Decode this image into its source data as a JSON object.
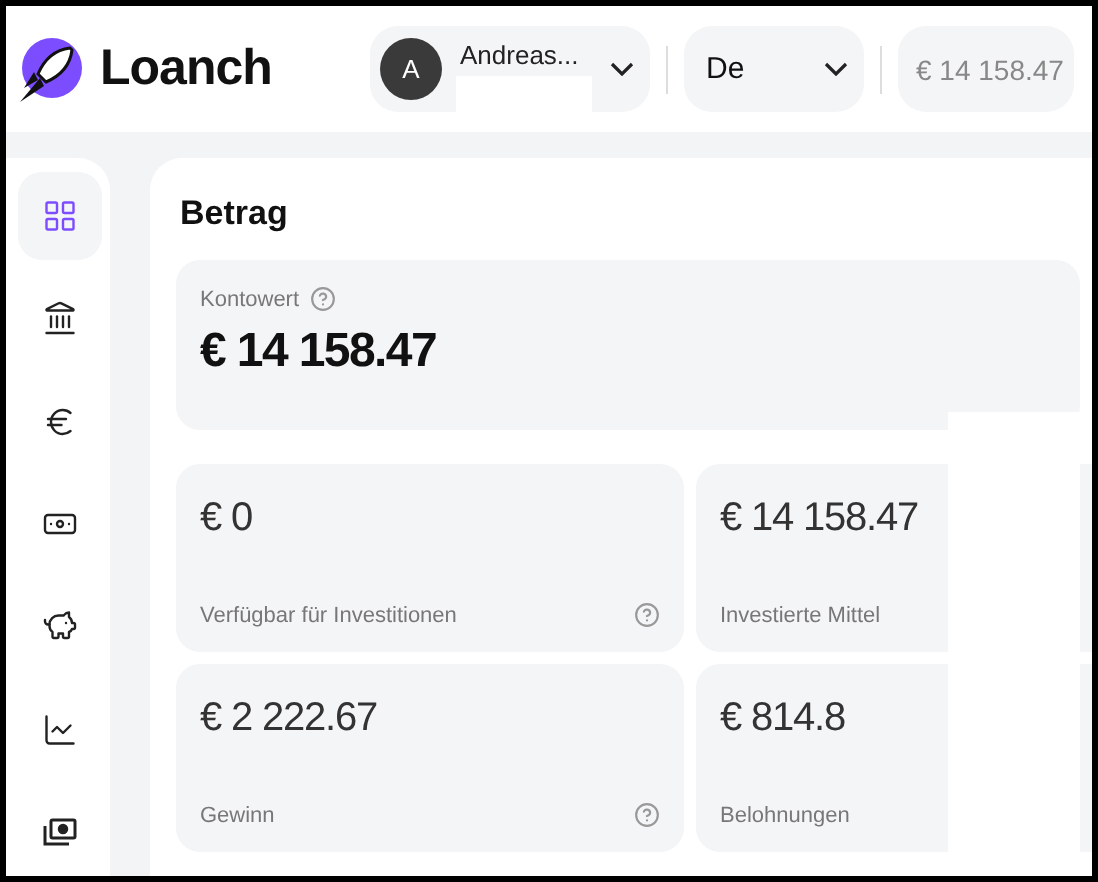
{
  "header": {
    "brand": "Loanch",
    "user": {
      "initial": "A",
      "name": "Andreas..."
    },
    "language": "De",
    "balance": "€ 14 158.47"
  },
  "sidebar": {
    "items": [
      {
        "kind": "grid",
        "selected": true
      },
      {
        "kind": "bank",
        "selected": false
      },
      {
        "kind": "euro",
        "selected": false
      },
      {
        "kind": "banknote",
        "selected": false
      },
      {
        "kind": "piggy",
        "selected": false
      },
      {
        "kind": "chart",
        "selected": false
      },
      {
        "kind": "cash",
        "selected": false
      }
    ]
  },
  "main": {
    "title": "Betrag",
    "summary": {
      "label": "Kontowert",
      "help": true,
      "value": "€ 14 158.47"
    },
    "stats": [
      {
        "value": "€ 0",
        "label": "Verfügbar für Investitionen",
        "help": true
      },
      {
        "value": "€ 14 158.47",
        "label": "Investierte Mittel",
        "help": false
      },
      {
        "value": "€ 2 222.67",
        "label": "Gewinn",
        "help": true
      },
      {
        "value": "€ 814.8",
        "label": "Belohnungen",
        "help": false
      }
    ]
  }
}
